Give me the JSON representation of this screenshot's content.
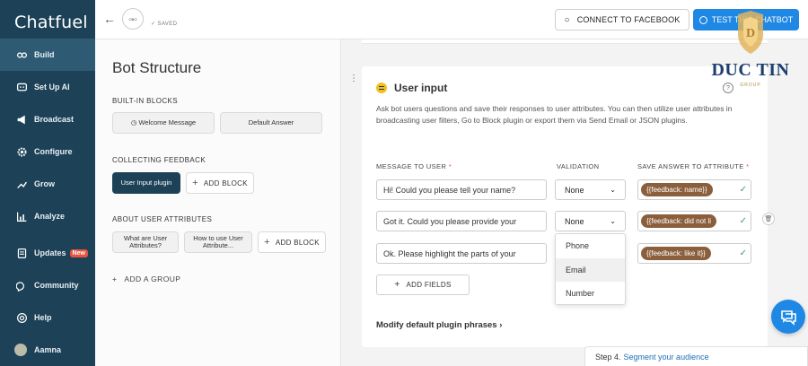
{
  "app": {
    "logo": "Chatfuel"
  },
  "sidebar": {
    "items": [
      {
        "label": "Build",
        "icon": "build-icon"
      },
      {
        "label": "Set Up AI",
        "icon": "ai-icon"
      },
      {
        "label": "Broadcast",
        "icon": "megaphone-icon"
      },
      {
        "label": "Configure",
        "icon": "gear-icon"
      },
      {
        "label": "Grow",
        "icon": "growth-icon"
      },
      {
        "label": "Analyze",
        "icon": "chart-icon"
      },
      {
        "label": "Updates",
        "icon": "bell-icon",
        "badge": "New"
      },
      {
        "label": "Community",
        "icon": "community-icon"
      },
      {
        "label": "Help",
        "icon": "help-icon"
      },
      {
        "label": "Aamna",
        "icon": "avatar"
      }
    ]
  },
  "topbar": {
    "bot_avatar_text": "OBO",
    "saved_text": "SAVED",
    "connect_label": "CONNECT TO FACEBOOK",
    "test_label": "TEST THIS CHATBOT"
  },
  "structure": {
    "title": "Bot Structure",
    "builtin_label": "BUILT-IN BLOCKS",
    "welcome_block": "Welcome Message",
    "default_block": "Default Answer",
    "feedback_label": "COLLECTING FEEDBACK",
    "user_input_block": "User Input plugin",
    "add_block": "ADD BLOCK",
    "attributes_label": "ABOUT USER ATTRIBUTES",
    "what_attr_block": "What are User Attributes?",
    "how_use_block": "How to use User Attribute...",
    "add_group": "ADD A GROUP"
  },
  "plugin": {
    "title": "User input",
    "description": "Ask bot users questions and save their responses to user attributes. You can then utilize user attributes in broadcasting user filters, Go to Block plugin or export them via Send Email or JSON plugins.",
    "col_message": "MESSAGE TO USER",
    "col_validation": "VALIDATION",
    "col_attribute": "SAVE ANSWER TO ATTRIBUTE",
    "rows": [
      {
        "message": "Hi! Could you please tell your name?",
        "validation": "None",
        "attribute": "{{feedback: name}}"
      },
      {
        "message": "Got it. Could you please provide your",
        "validation": "None",
        "attribute": "{{feedback: did not li"
      },
      {
        "message": "Ok. Please highlight the parts of your",
        "validation": "",
        "attribute": "{{feedback: like it}}"
      }
    ],
    "dropdown_options": [
      "Phone",
      "Email",
      "Number"
    ],
    "add_fields": "ADD FIELDS",
    "modify_label": "Modify default plugin phrases"
  },
  "watermark": {
    "name": "DUC TIN",
    "sub": "GROUP"
  },
  "stepbar": {
    "prefix": "Step 4.",
    "link": "Segment your audience"
  }
}
